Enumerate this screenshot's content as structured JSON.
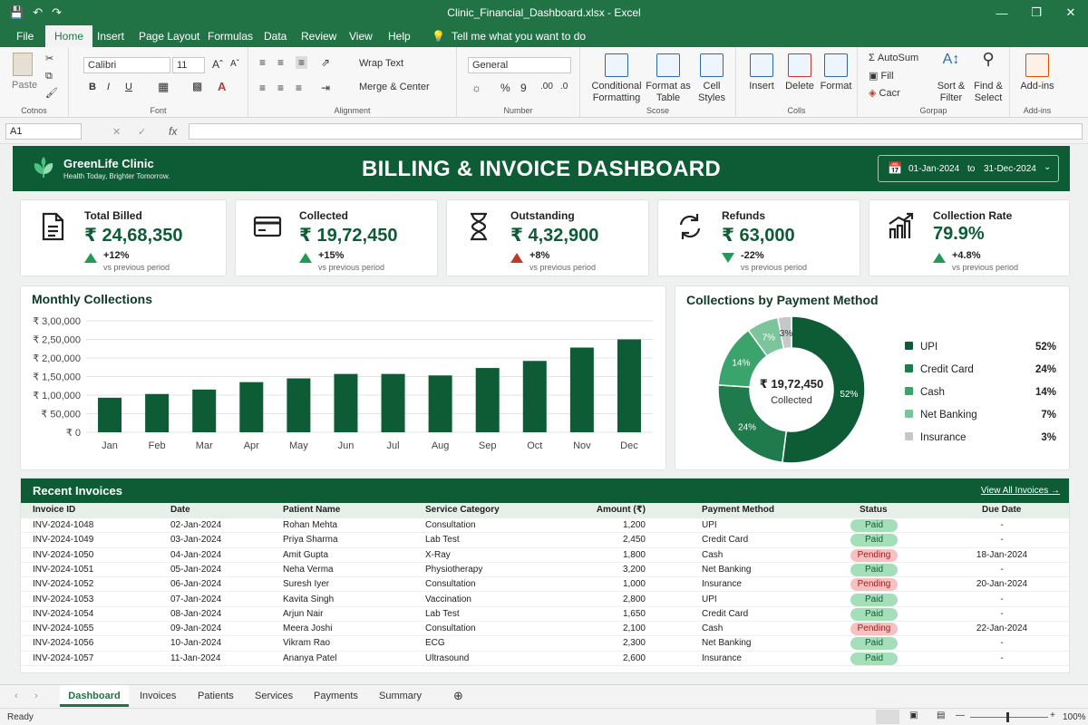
{
  "window": {
    "title": "Clinic_Financial_Dashboard.xlsx - Excel"
  },
  "menu": [
    "File",
    "Home",
    "Insert",
    "Page Layout",
    "Formulas",
    "Data",
    "Review",
    "View",
    "Help"
  ],
  "tell_me": "Tell me what you want to do",
  "ribbon": {
    "font_name": "Calibri",
    "font_size": "11",
    "number_format": "General",
    "wrap_text": "Wrap Text",
    "merge_center": "Merge & Center",
    "paste": "Paste",
    "cond_fmt_1": "Conditional",
    "cond_fmt_2": "Formatting",
    "fmt_table_1": "Format as",
    "fmt_table_2": "Table",
    "cell_styles_1": "Cell",
    "cell_styles_2": "Styles",
    "insert": "Insert",
    "delete": "Delete",
    "format": "Format",
    "autosum": "AutoSum",
    "fill": "Fill",
    "clear": "Cacr",
    "sort_1": "Sort &",
    "sort_2": "Filter",
    "find_1": "Find &",
    "find_2": "Select",
    "addins": "Add-ins",
    "groups": {
      "clipboard": "Cotnos",
      "font": "Font",
      "alignment": "Alignment",
      "number": "Number",
      "styles": "Scose",
      "cells": "Colls",
      "editing": "Gorpap",
      "addins": "Add-ins"
    }
  },
  "name_box": "A1",
  "dashboard": {
    "clinic": "GreenLife Clinic",
    "tagline": "Health Today, Brighter Tomorrow.",
    "title": "BILLING & INVOICE DASHBOARD",
    "date_from": "01-Jan-2024",
    "date_to_word": "to",
    "date_to": "31-Dec-2024"
  },
  "kpis": [
    {
      "label": "Total Billed",
      "value": "₹ 24,68,350",
      "change": "+12%",
      "sub": "vs previous period",
      "direction": "up"
    },
    {
      "label": "Collected",
      "value": "₹ 19,72,450",
      "change": "+15%",
      "sub": "vs previous period",
      "direction": "up"
    },
    {
      "label": "Outstanding",
      "value": "₹ 4,32,900",
      "change": "+8%",
      "sub": "vs previous period",
      "direction": "up-bad"
    },
    {
      "label": "Refunds",
      "value": "₹ 63,000",
      "change": "-22%",
      "sub": "vs previous period",
      "direction": "down"
    },
    {
      "label": "Collection Rate",
      "value": "79.9%",
      "change": "+4.8%",
      "sub": "vs previous period",
      "direction": "up"
    }
  ],
  "colors": {
    "brand": "#0d5c36",
    "excel": "#217346",
    "up": "#1e9c53",
    "bad": "#c0392b"
  },
  "chart_data": [
    {
      "type": "bar",
      "title": "Monthly Collections",
      "categories": [
        "Jan",
        "Feb",
        "Mar",
        "Apr",
        "May",
        "Jun",
        "Jul",
        "Aug",
        "Sep",
        "Oct",
        "Nov",
        "Dec"
      ],
      "values": [
        93000,
        103000,
        115000,
        135000,
        145000,
        157000,
        157000,
        153000,
        173000,
        192000,
        228000,
        250000
      ],
      "ylim": [
        0,
        300000
      ],
      "yticks": [
        "₹ 0",
        "₹ 50,000",
        "₹ 1,00,000",
        "₹ 1,50,000",
        "₹ 2,00,000",
        "₹ 2,50,000",
        "₹ 3,00,000"
      ],
      "grid": true
    },
    {
      "type": "pie",
      "title": "Collections by Payment Method",
      "center_value": "₹ 19,72,450",
      "center_label": "Collected",
      "categories": [
        "UPI",
        "Credit Card",
        "Cash",
        "Net Banking",
        "Insurance"
      ],
      "values": [
        52,
        24,
        14,
        7,
        3
      ],
      "labels": [
        "52%",
        "24%",
        "14%",
        "7%",
        "3%"
      ],
      "colors": [
        "#0d5c36",
        "#1f7a4c",
        "#3aa46c",
        "#7cc49b",
        "#c7c7c7"
      ],
      "legend": "right"
    }
  ],
  "invoices": {
    "title": "Recent Invoices",
    "view_all": "View All Invoices →",
    "columns": [
      "Invoice ID",
      "Date",
      "Patient Name",
      "Service Category",
      "Amount (₹)",
      "Payment Method",
      "Status",
      "Due Date"
    ],
    "rows": [
      [
        "INV-2024-1048",
        "02-Jan-2024",
        "Rohan Mehta",
        "Consultation",
        "1,200",
        "UPI",
        "Paid",
        "-"
      ],
      [
        "INV-2024-1049",
        "03-Jan-2024",
        "Priya Sharma",
        "Lab Test",
        "2,450",
        "Credit Card",
        "Paid",
        "-"
      ],
      [
        "INV-2024-1050",
        "04-Jan-2024",
        "Amit Gupta",
        "X-Ray",
        "1,800",
        "Cash",
        "Pending",
        "18-Jan-2024"
      ],
      [
        "INV-2024-1051",
        "05-Jan-2024",
        "Neha Verma",
        "Physiotherapy",
        "3,200",
        "Net Banking",
        "Paid",
        "-"
      ],
      [
        "INV-2024-1052",
        "06-Jan-2024",
        "Suresh Iyer",
        "Consultation",
        "1,000",
        "Insurance",
        "Pending",
        "20-Jan-2024"
      ],
      [
        "INV-2024-1053",
        "07-Jan-2024",
        "Kavita Singh",
        "Vaccination",
        "2,800",
        "UPI",
        "Paid",
        "-"
      ],
      [
        "INV-2024-1054",
        "08-Jan-2024",
        "Arjun Nair",
        "Lab Test",
        "1,650",
        "Credit Card",
        "Paid",
        "-"
      ],
      [
        "INV-2024-1055",
        "09-Jan-2024",
        "Meera Joshi",
        "Consultation",
        "2,100",
        "Cash",
        "Pending",
        "22-Jan-2024"
      ],
      [
        "INV-2024-1056",
        "10-Jan-2024",
        "Vikram Rao",
        "ECG",
        "2,300",
        "Net Banking",
        "Paid",
        "-"
      ],
      [
        "INV-2024-1057",
        "11-Jan-2024",
        "Ananya Patel",
        "Ultrasound",
        "2,600",
        "Insurance",
        "Paid",
        "-"
      ]
    ]
  },
  "sheet_tabs": [
    "Dashboard",
    "Invoices",
    "Patients",
    "Services",
    "Payments",
    "Summary"
  ],
  "status": {
    "ready": "Ready",
    "zoom": "100%"
  }
}
